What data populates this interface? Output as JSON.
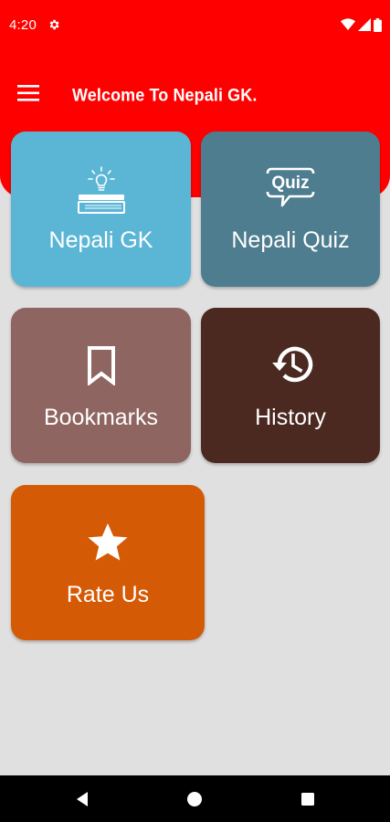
{
  "status_bar": {
    "time": "4:20",
    "icons": [
      "settings-gear-icon",
      "wifi-icon",
      "cellular-signal-icon",
      "battery-icon"
    ]
  },
  "toolbar": {
    "title": "Welcome To Nepali GK.",
    "menu_icon": "hamburger-menu-icon"
  },
  "colors": {
    "header": "#ff0000",
    "background": "#e0e0e0",
    "card_gk": "#5bb6d6",
    "card_quiz": "#4e7d8f",
    "card_bookmarks": "#8e6560",
    "card_history": "#4b2921",
    "card_rate": "#d55a05"
  },
  "cards": [
    {
      "label": "Nepali GK",
      "icon": "book-lightbulb-icon"
    },
    {
      "label": "Nepali Quiz",
      "icon": "quiz-speech-bubble-icon"
    },
    {
      "label": "Bookmarks",
      "icon": "bookmark-icon"
    },
    {
      "label": "History",
      "icon": "history-icon"
    },
    {
      "label": "Rate Us",
      "icon": "star-icon"
    }
  ],
  "quiz_icon_text": "Quiz",
  "nav_bar": {
    "buttons": [
      "back-icon",
      "home-icon",
      "recents-icon"
    ]
  }
}
